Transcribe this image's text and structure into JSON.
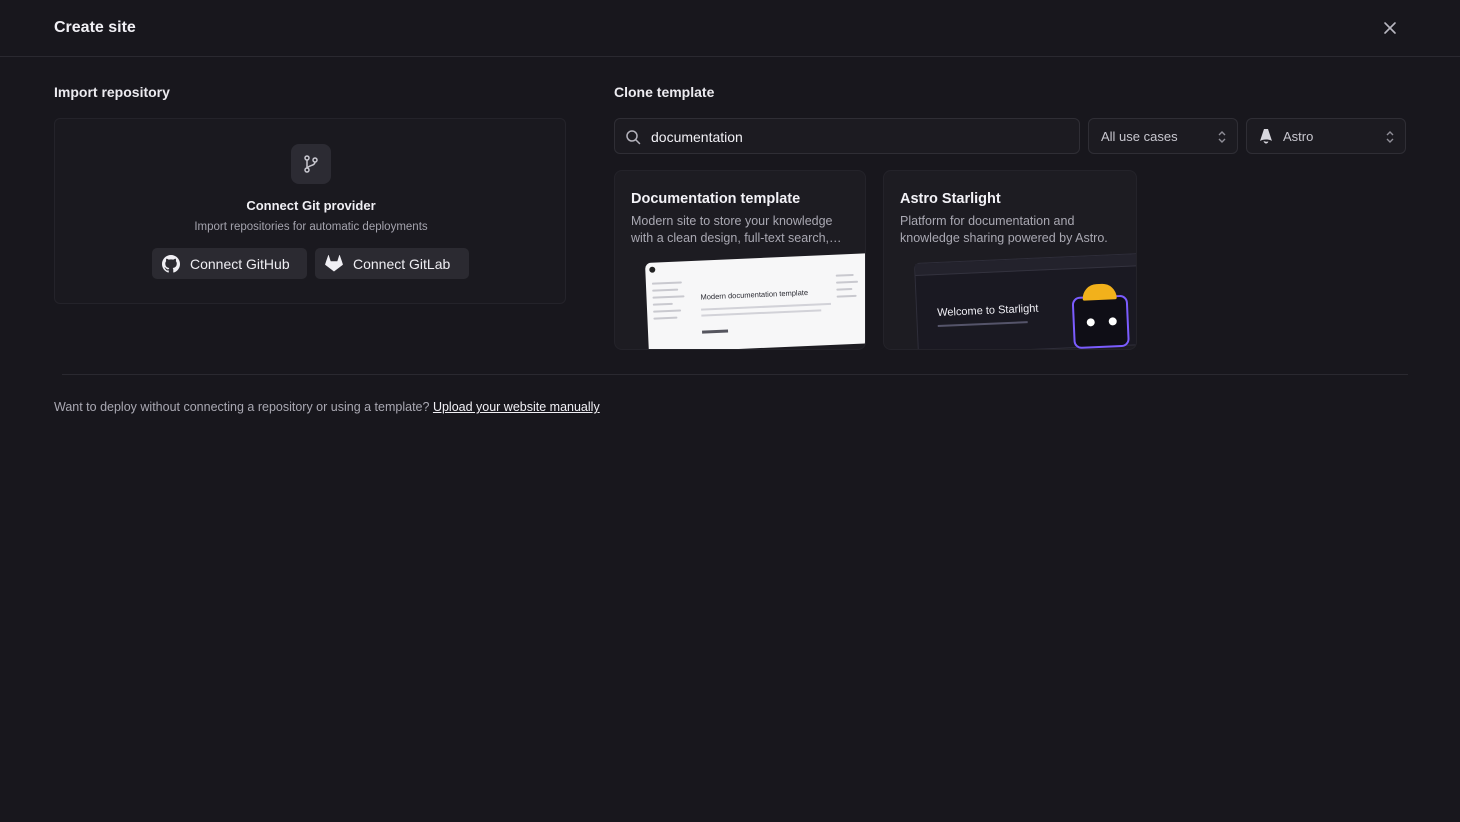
{
  "header": {
    "title": "Create site"
  },
  "import": {
    "section_title": "Import repository",
    "heading": "Connect Git provider",
    "subtitle": "Import repositories for automatic deployments",
    "github_label": "Connect GitHub",
    "gitlab_label": "Connect GitLab"
  },
  "clone": {
    "section_title": "Clone template",
    "search_value": "documentation",
    "use_case_select": "All use cases",
    "framework_select": "Astro",
    "templates": [
      {
        "title": "Documentation template",
        "description": "Modern site to store your knowledge with a clean design, full-text search,…",
        "preview_heading": "Modern documentation template"
      },
      {
        "title": "Astro Starlight",
        "description": "Platform for documentation and knowledge sharing powered by Astro.",
        "preview_heading": "Welcome to Starlight"
      }
    ]
  },
  "footer": {
    "text": "Want to deploy without connecting a repository or using a template?",
    "link": "Upload your website manually"
  },
  "icons": {
    "close": "close-icon",
    "branch": "git-branch-icon",
    "github": "github-icon",
    "gitlab": "gitlab-icon",
    "search": "search-icon",
    "astro": "astro-icon",
    "chevrons": "chevron-up-down-icon"
  }
}
